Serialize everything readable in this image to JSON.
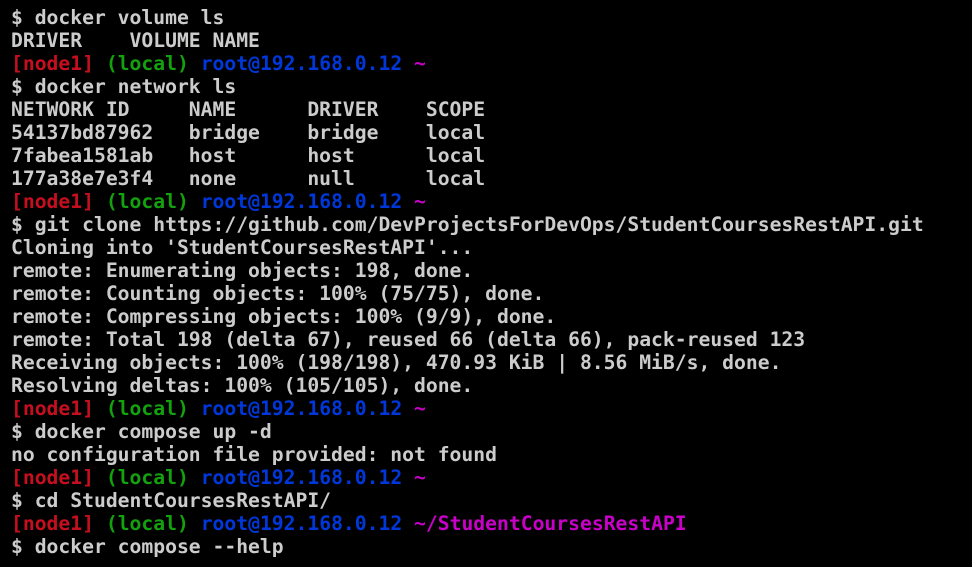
{
  "terminal": {
    "colors": {
      "background": "#000000",
      "foreground": "#cccccc",
      "node": "#c50f1f",
      "local": "#13a10e",
      "user": "#0037da",
      "path": "#c800c8"
    },
    "prompt": {
      "node": "[node1]",
      "local": "(local)",
      "user": "root@192.168.0.12"
    },
    "lines": [
      "$ docker volume ls",
      "DRIVER    VOLUME NAME",
      "~",
      "$ docker network ls",
      "NETWORK ID     NAME      DRIVER    SCOPE",
      "54137bd87962   bridge    bridge    local",
      "7fabea1581ab   host      host      local",
      "177a38e7e3f4   none      null      local",
      "~",
      "$ git clone https://github.com/DevProjectsForDevOps/StudentCoursesRestAPI.git",
      "Cloning into 'StudentCoursesRestAPI'...",
      "remote: Enumerating objects: 198, done.",
      "remote: Counting objects: 100% (75/75), done.",
      "remote: Compressing objects: 100% (9/9), done.",
      "remote: Total 198 (delta 67), reused 66 (delta 66), pack-reused 123",
      "Receiving objects: 100% (198/198), 470.93 KiB | 8.56 MiB/s, done.",
      "Resolving deltas: 100% (105/105), done.",
      "~",
      "$ docker compose up -d",
      "no configuration file provided: not found",
      "~",
      "$ cd StudentCoursesRestAPI/",
      "~/StudentCoursesRestAPI",
      "$ docker compose --help"
    ]
  }
}
